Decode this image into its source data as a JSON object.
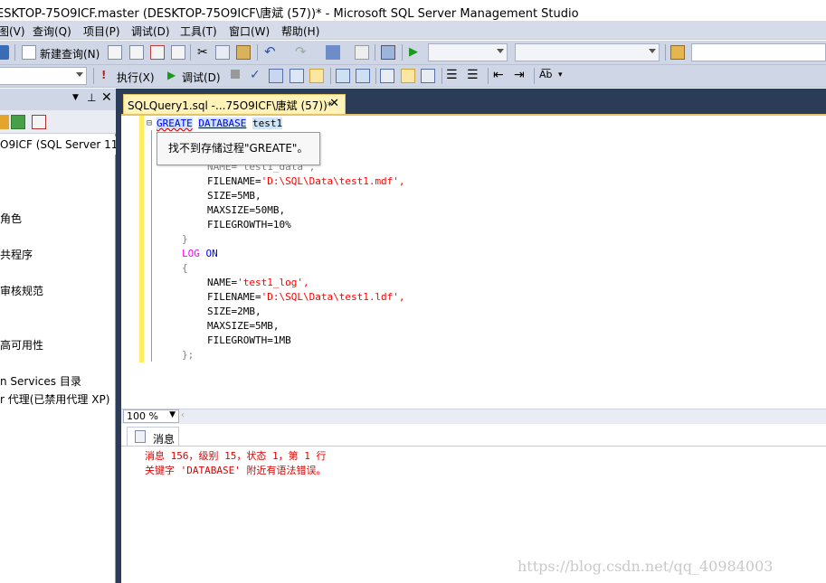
{
  "window": {
    "title": "ESKTOP-75O9ICF.master (DESKTOP-75O9ICF\\唐斌 (57))* - Microsoft SQL Server Management Studio"
  },
  "menu": [
    "图(V)",
    "查询(Q)",
    "项目(P)",
    "调试(D)",
    "工具(T)",
    "窗口(W)",
    "帮助(H)"
  ],
  "toolbar1": {
    "new_query": "新建查询(N)"
  },
  "toolbar2": {
    "execute": "执行(X)",
    "debug": "调试(D)"
  },
  "explorer": {
    "server": "O9ICF (SQL Server 11.0",
    "items": [
      "角色",
      "共程序",
      "审核规范",
      "高可用性",
      "n Services 目录",
      "r 代理(已禁用代理 XP)"
    ]
  },
  "tab": {
    "label": "SQLQuery1.sql -...75O9ICF\\唐斌 (57))*"
  },
  "tooltip": {
    "text": "找不到存储过程\"GREATE\"。"
  },
  "code": {
    "line1": {
      "kw1": "GREATE",
      "kw2": "DATABASE",
      "name": "test1"
    },
    "line_name_partial": "NAME='test1_data',",
    "data": {
      "filename_key": "FILENAME=",
      "filename_val": "'D:\\SQL\\Data\\test1.mdf',",
      "size": "SIZE=5MB,",
      "maxsize": "MAXSIZE=50MB,",
      "growth": "FILEGROWTH=10%"
    },
    "close1": "}",
    "log_on": {
      "kw1": "LOG",
      "kw2": "ON"
    },
    "open2": "{",
    "log": {
      "name_key": "NAME=",
      "name_val": "'test1_log',",
      "filename_key": "FILENAME=",
      "filename_val": "'D:\\SQL\\Data\\test1.ldf',",
      "size": "SIZE=2MB,",
      "maxsize": "MAXSIZE=5MB,",
      "growth": "FILEGROWTH=1MB"
    },
    "close2": "};"
  },
  "zoom": {
    "value": "100 %"
  },
  "results": {
    "tab": "消息",
    "line1": "消息 156，级别 15，状态 1，第 1 行",
    "line2": "关键字 'DATABASE' 附近有语法错误。"
  },
  "watermark": "https://blog.csdn.net/qq_40984003",
  "colors": {
    "keyword": "#0000ff",
    "string": "#ff0000",
    "error": "#e00000",
    "tab_active": "#fff3b8",
    "frame": "#2b3c59"
  }
}
